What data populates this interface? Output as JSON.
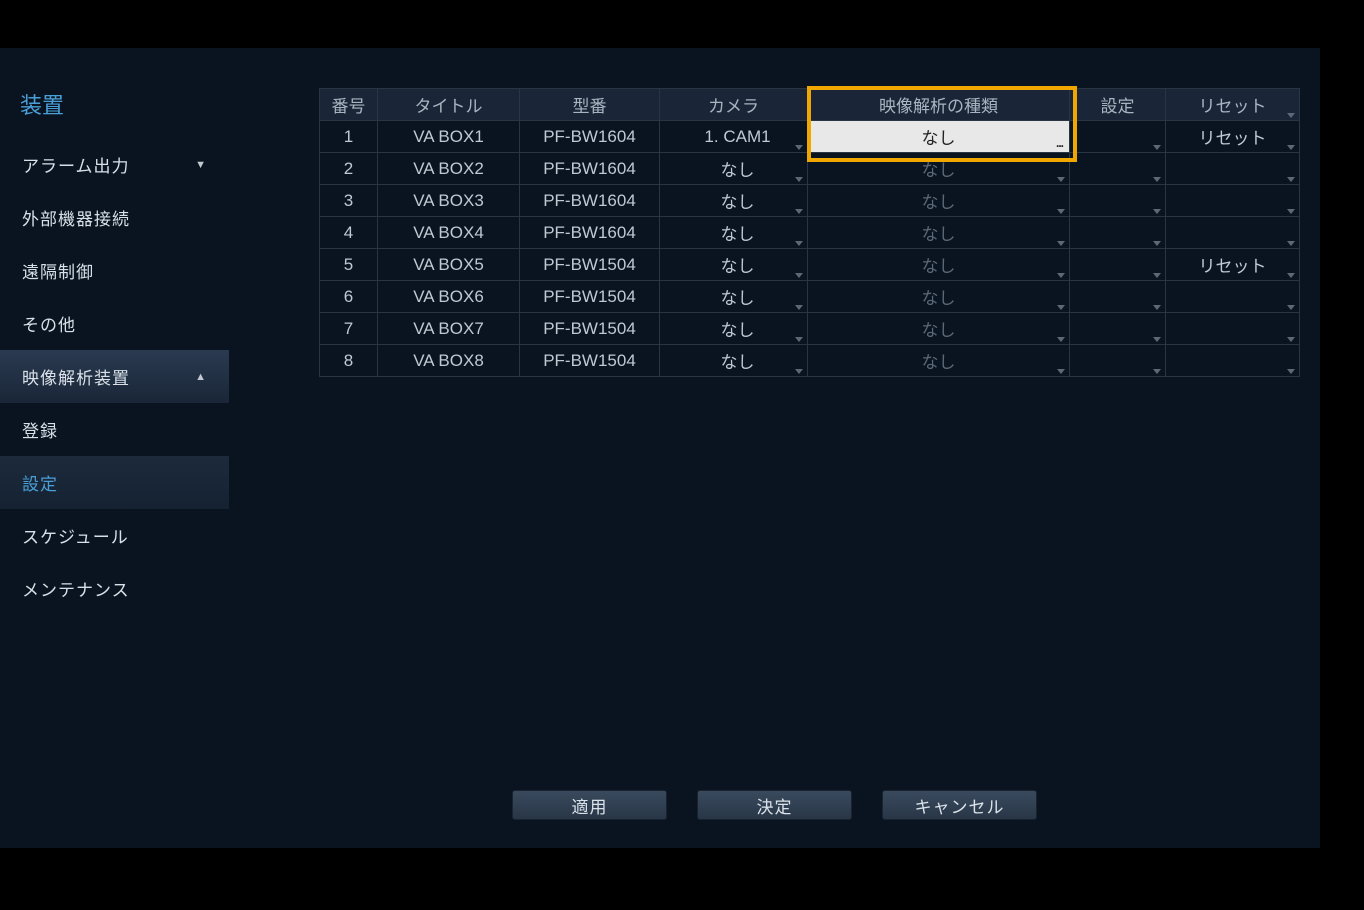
{
  "sidebar": {
    "title": "装置",
    "items": [
      {
        "label": "アラーム出力",
        "type": "expandable",
        "expanded": false
      },
      {
        "label": "外部機器接続",
        "type": "plain"
      },
      {
        "label": "遠隔制御",
        "type": "plain"
      },
      {
        "label": "その他",
        "type": "plain"
      },
      {
        "label": "映像解析装置",
        "type": "expandable",
        "expanded": true
      }
    ],
    "subitems": [
      {
        "label": "登録",
        "active": false
      },
      {
        "label": "設定",
        "active": true
      },
      {
        "label": "スケジュール",
        "active": false
      },
      {
        "label": "メンテナンス",
        "active": false
      }
    ]
  },
  "table": {
    "headers": [
      "番号",
      "タイトル",
      "型番",
      "カメラ",
      "映像解析の種類",
      "設定",
      "リセット"
    ],
    "rows": [
      {
        "num": "1",
        "title": "VA BOX1",
        "model": "PF-BW1604",
        "camera": "1. CAM1",
        "type": "なし",
        "typeActive": true,
        "settings": "",
        "reset": "リセット",
        "dim": false
      },
      {
        "num": "2",
        "title": "VA BOX2",
        "model": "PF-BW1604",
        "camera": "なし",
        "type": "なし",
        "typeActive": false,
        "settings": "",
        "reset": "",
        "dim": true
      },
      {
        "num": "3",
        "title": "VA BOX3",
        "model": "PF-BW1604",
        "camera": "なし",
        "type": "なし",
        "typeActive": false,
        "settings": "",
        "reset": "",
        "dim": true
      },
      {
        "num": "4",
        "title": "VA BOX4",
        "model": "PF-BW1604",
        "camera": "なし",
        "type": "なし",
        "typeActive": false,
        "settings": "",
        "reset": "",
        "dim": true
      },
      {
        "num": "5",
        "title": "VA BOX5",
        "model": "PF-BW1504",
        "camera": "なし",
        "type": "なし",
        "typeActive": false,
        "settings": "",
        "reset": "リセット",
        "dim": true
      },
      {
        "num": "6",
        "title": "VA BOX6",
        "model": "PF-BW1504",
        "camera": "なし",
        "type": "なし",
        "typeActive": false,
        "settings": "",
        "reset": "",
        "dim": true
      },
      {
        "num": "7",
        "title": "VA BOX7",
        "model": "PF-BW1504",
        "camera": "なし",
        "type": "なし",
        "typeActive": false,
        "settings": "",
        "reset": "",
        "dim": true
      },
      {
        "num": "8",
        "title": "VA BOX8",
        "model": "PF-BW1504",
        "camera": "なし",
        "type": "なし",
        "typeActive": false,
        "settings": "",
        "reset": "",
        "dim": true
      }
    ]
  },
  "footer": {
    "apply": "適用",
    "ok": "決定",
    "cancel": "キャンセル"
  },
  "ellipsis": "..."
}
